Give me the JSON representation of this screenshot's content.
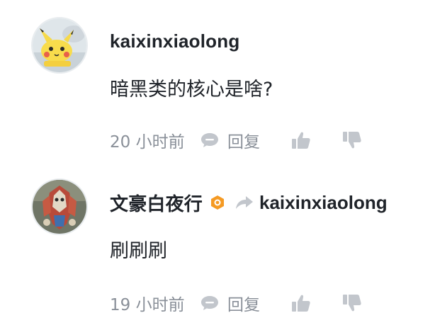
{
  "comments": [
    {
      "username": "kaixinxiaolong",
      "content": "暗黑类的核心是啥?",
      "time": "20 小时前",
      "reply_label": "回复",
      "avatar_icon": "pikachu-avatar-icon"
    },
    {
      "username": "文豪白夜行",
      "badge_icon": "verified-hexagon-badge-icon",
      "badge_color": "#f59a23",
      "reply_to": "kaixinxiaolong",
      "content": "刷刷刷",
      "time": "19 小时前",
      "reply_label": "回复",
      "avatar_icon": "armored-character-avatar-icon"
    }
  ],
  "colors": {
    "text_primary": "#1f2329",
    "text_secondary": "#8a9099",
    "icon_gray": "#c2c6cc"
  }
}
